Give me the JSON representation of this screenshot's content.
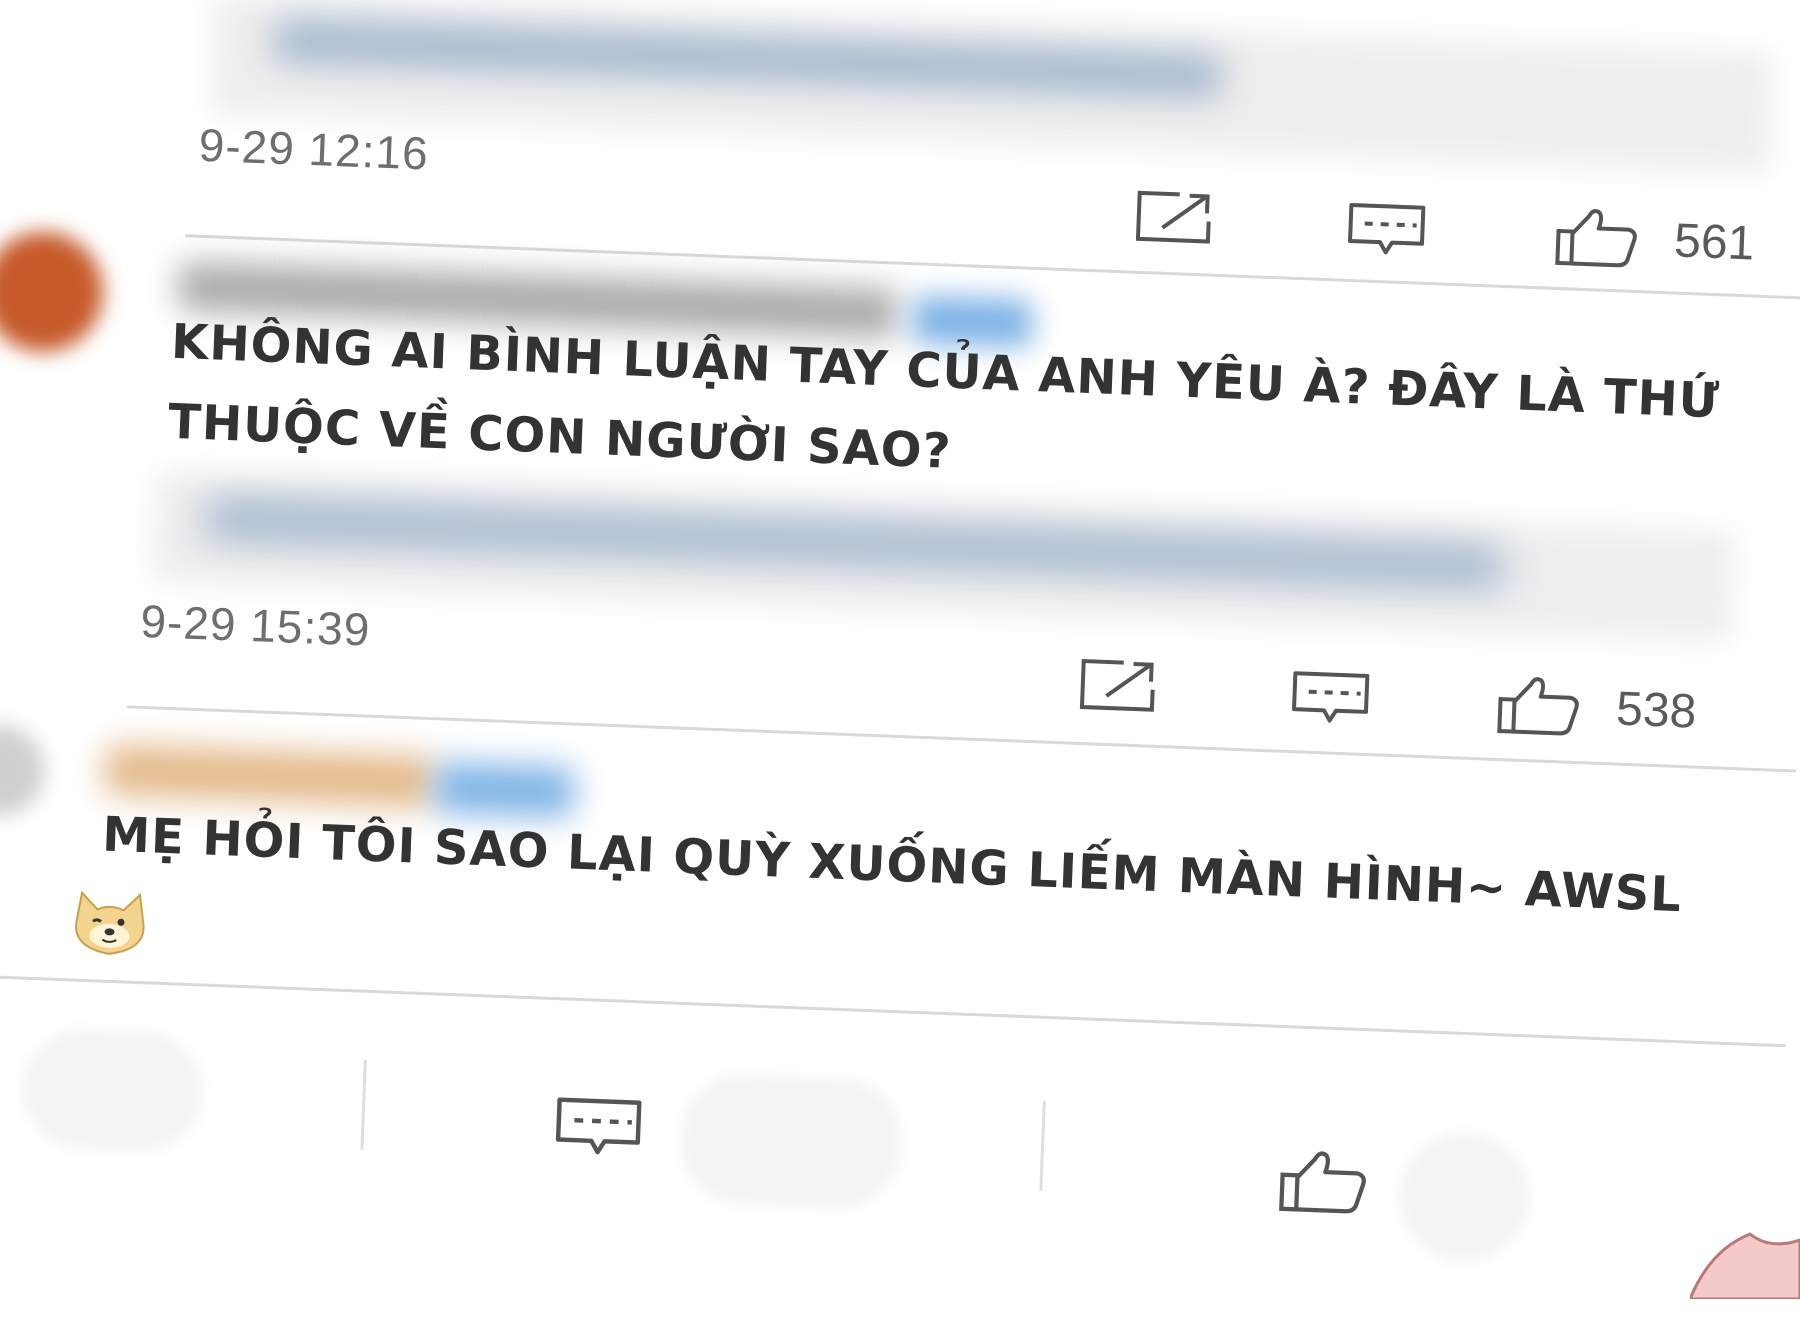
{
  "comments": [
    {
      "timestamp": "9-29 12:16",
      "likes": "561"
    },
    {
      "text_line1": "KHÔNG AI BÌNH LUẬN TAY CỦA ANH YÊU À? ĐÂY LÀ THỨ",
      "text_line2": "THUỘC VỀ CON NGƯỜI SAO?",
      "timestamp": "9-29 15:39",
      "likes": "538"
    },
    {
      "text": "MẸ HỎI TÔI SAO LẠI QUỲ XUỐNG LIẾM MÀN HÌNH~ AWSL",
      "emoji": "doge-emoji"
    }
  ],
  "icons": {
    "share": "share-icon",
    "comment": "comment-icon",
    "like": "thumbs-up-icon"
  },
  "colors": {
    "text": "#333333",
    "timestamp": "#6e6e6e",
    "divider": "#d9d9d9",
    "blurred_tag": "#7fb3e6"
  }
}
